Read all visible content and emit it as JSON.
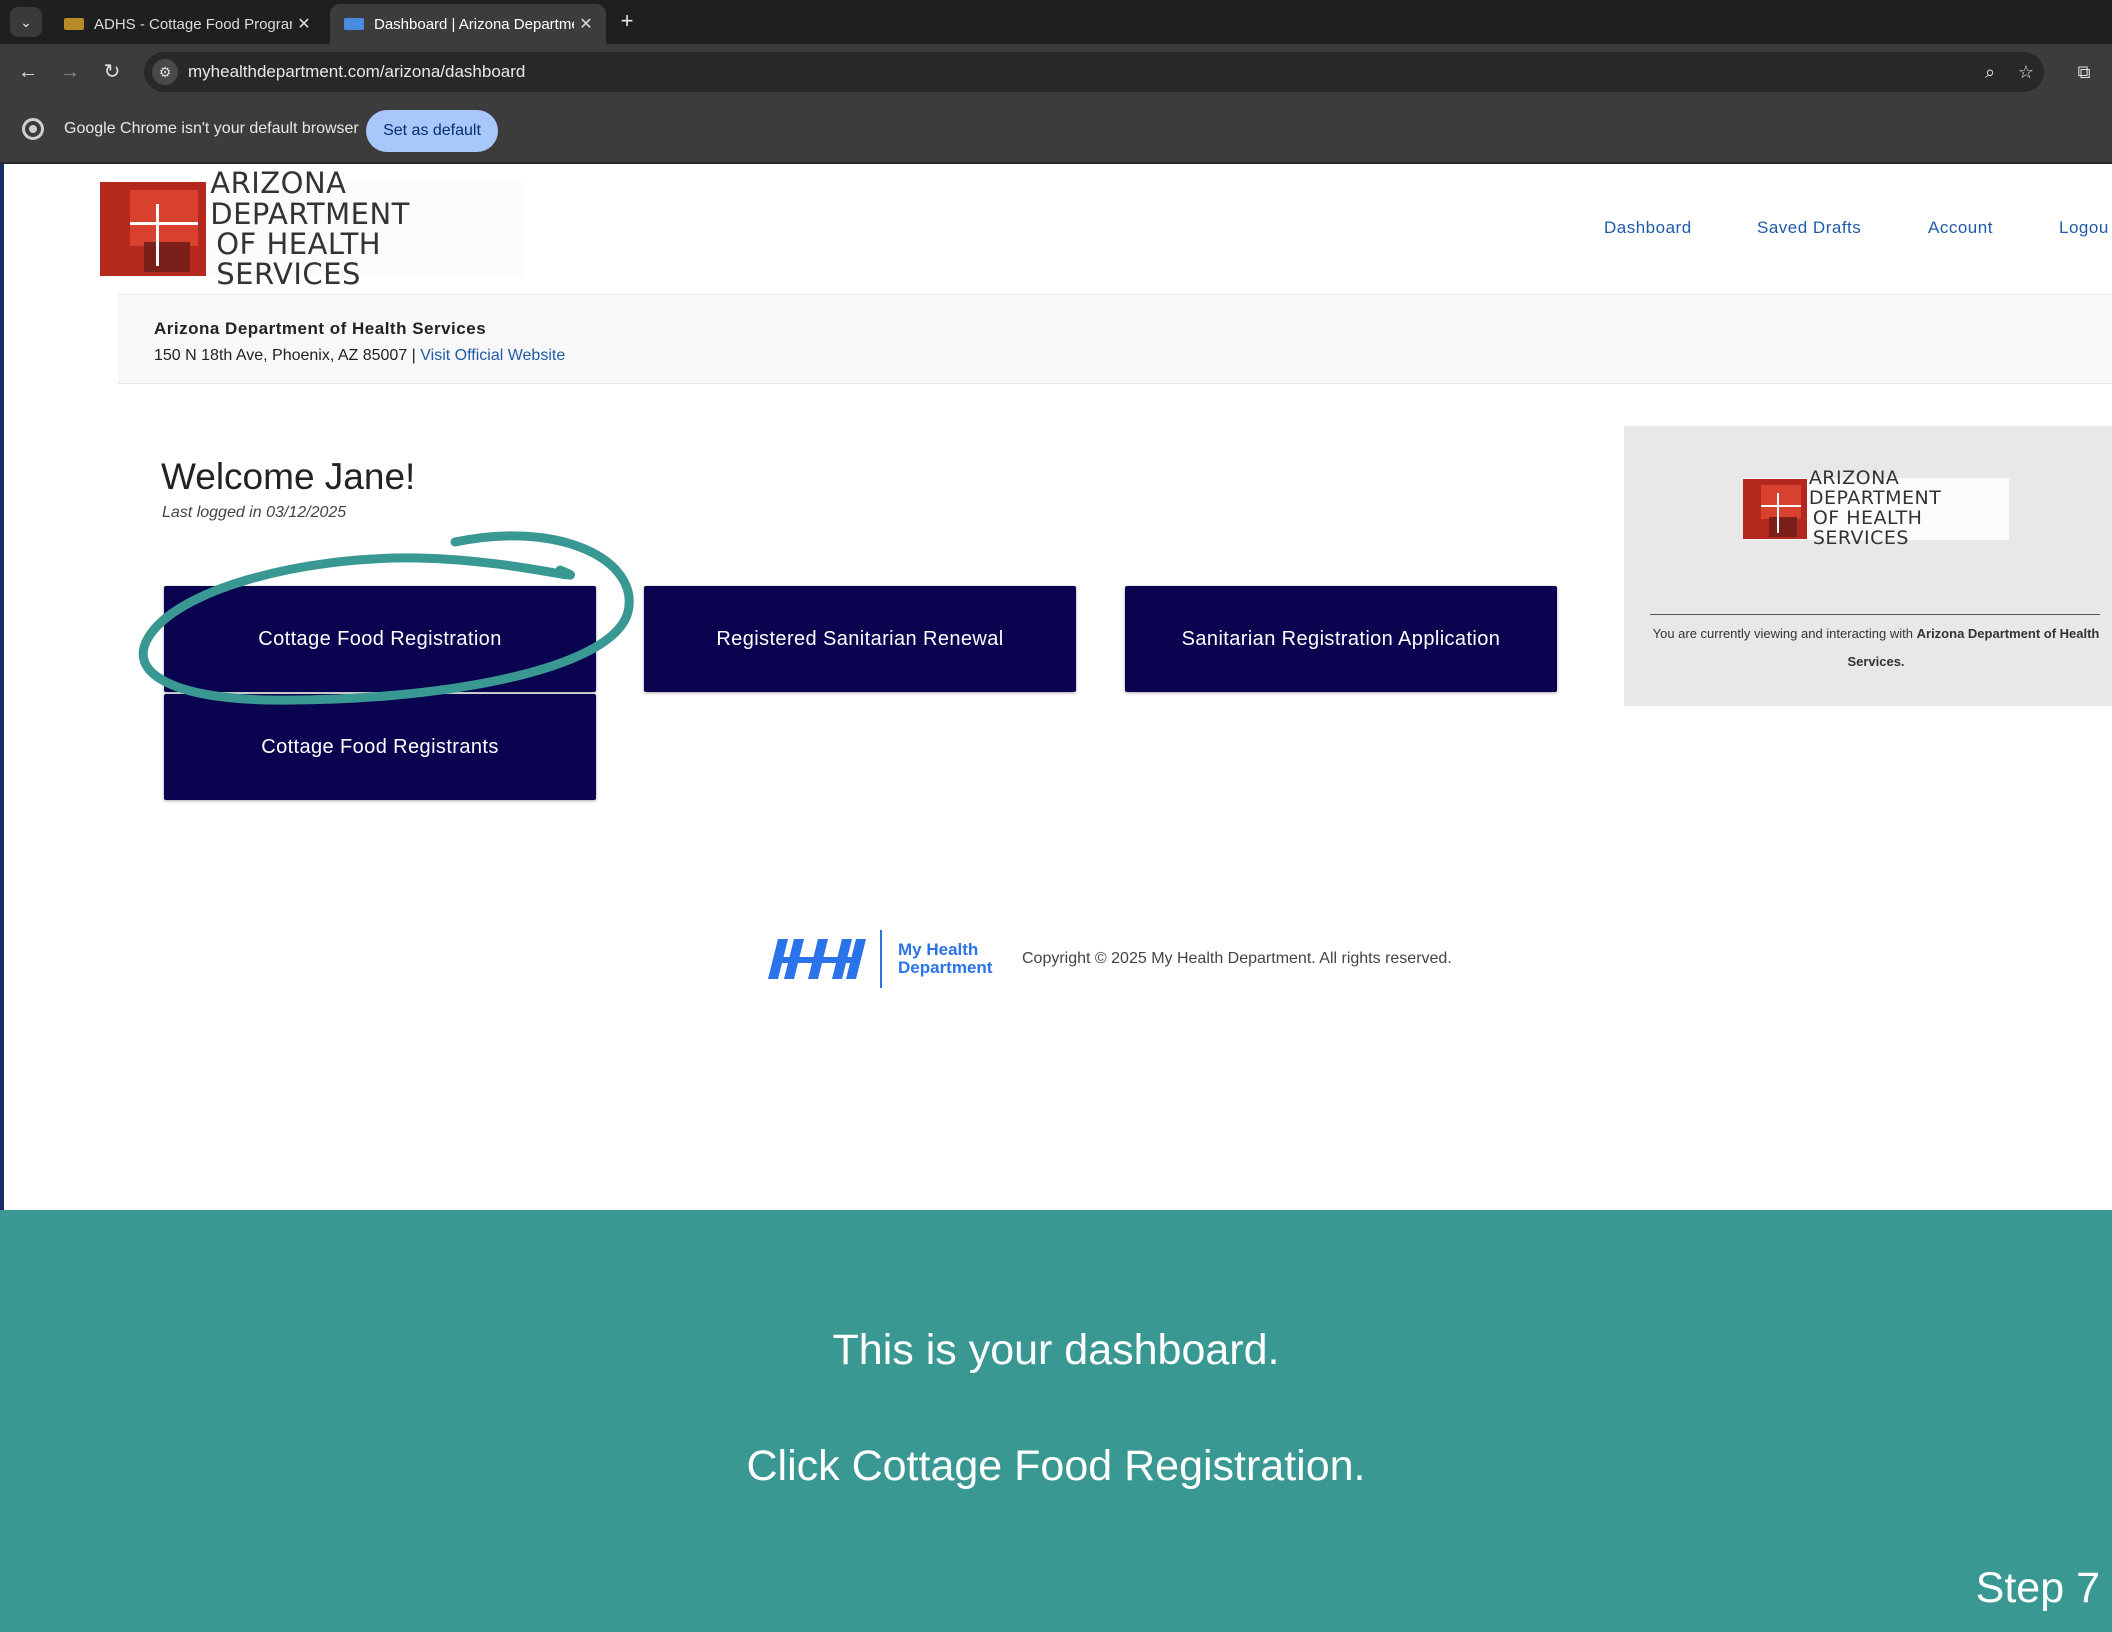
{
  "browser": {
    "tabs": [
      {
        "title": "ADHS - Cottage Food Program",
        "active": false
      },
      {
        "title": "Dashboard | Arizona Department",
        "active": true
      }
    ],
    "url": "myhealthdepartment.com/arizona/dashboard",
    "infobar": {
      "message": "Google Chrome isn't your default browser",
      "button": "Set as default"
    }
  },
  "header": {
    "logo_line1": "ARIZONA DEPARTMENT",
    "logo_line2": "OF HEALTH SERVICES",
    "nav": [
      "Dashboard",
      "Saved Drafts",
      "Account",
      "Logou"
    ]
  },
  "org": {
    "name": "Arizona Department of Health Services",
    "address": "150 N 18th Ave, Phoenix, AZ 85007 |",
    "website_link": "Visit Official Website"
  },
  "welcome": {
    "title": "Welcome Jane!",
    "last_login": "Last logged in 03/12/2025"
  },
  "actions": [
    "Cottage Food Registration",
    "Registered Sanitarian Renewal",
    "Sanitarian Registration Application",
    "Cottage Food Registrants"
  ],
  "side_card": {
    "logo_line1": "ARIZONA DEPARTMENT",
    "logo_line2": "OF HEALTH SERVICES",
    "note_prefix": "You are currently viewing and interacting with",
    "note_org": "Arizona Department of Health Services."
  },
  "footer": {
    "brand_line1": "My Health",
    "brand_line2": "Department",
    "copyright": "Copyright © 2025 My Health Department. All rights reserved."
  },
  "instruction": {
    "line1": "This is your dashboard.",
    "line2": "Click Cottage Food Registration.",
    "step": "Step 7"
  },
  "colors": {
    "button_bg": "#0a0450",
    "banner_bg": "#3a9892",
    "highlight_ring": "#3a9892",
    "link": "#1f5aa8",
    "logo_red": "#b5281e"
  }
}
